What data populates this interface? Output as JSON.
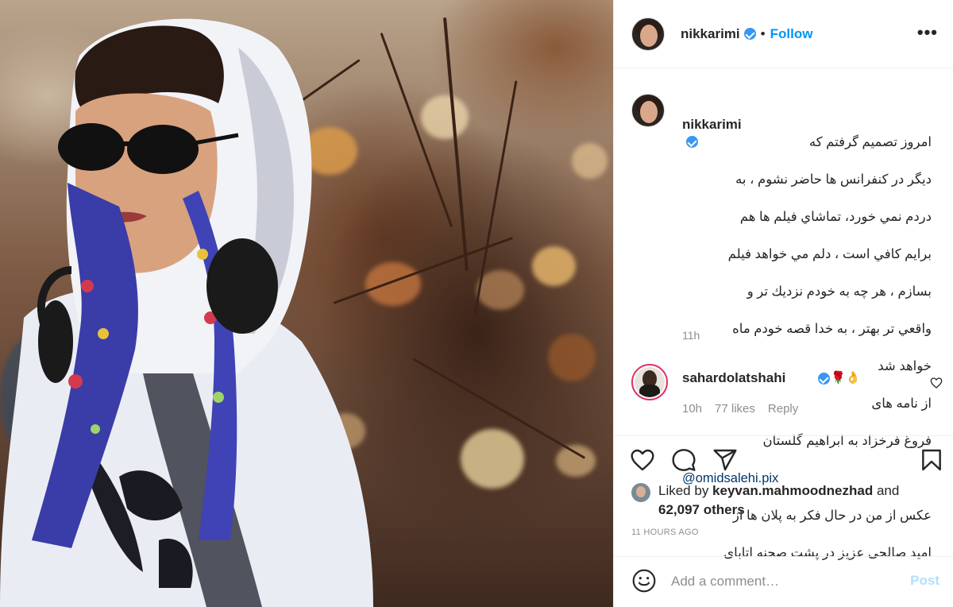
{
  "header": {
    "username": "nikkarimi",
    "separator": "•",
    "follow_label": "Follow",
    "more_label": "•••"
  },
  "caption": {
    "username": "nikkarimi",
    "lines": [
      "امروز تصميم گرفتم كه",
      "ديگر در كنفرانس ها حاضر نشوم ، به",
      "دردم نمي خورد، تماشاي فيلم ها هم",
      "برايم كافي است ، دلم مي خواهد فيلم",
      "بسازم ، هر چه به خودم نزديك تر و",
      "واقعي تر بهتر ، به خدا قصه خودم ماه",
      "خواهد شد",
      "از نامه های",
      "فروغ فرخزاد به ابراهیم گلستان"
    ],
    "mention": "@omidsalehi.pix",
    "lines_after": [
      "عکس از من در حال فکر به پلان ها از",
      "امید صالحی عزیز در پشت صحنه اتابای"
    ],
    "time": "11h"
  },
  "comment": {
    "username": "sahardolatshahi",
    "emoji": "🌹👌",
    "time": "10h",
    "likes": "77 likes",
    "reply_label": "Reply"
  },
  "likes": {
    "prefix": "Liked by ",
    "user": "keyvan.mahmoodnezhad",
    "middle": " and",
    "others": "62,097 others"
  },
  "timestamp": "11 HOURS AGO",
  "add_comment": {
    "placeholder": "Add a comment…",
    "post_label": "Post"
  },
  "colors": {
    "link_blue": "#0095f6",
    "verified_blue": "#3897f0",
    "muted_gray": "#8e8e8e",
    "post_disabled": "#b2dffc"
  }
}
